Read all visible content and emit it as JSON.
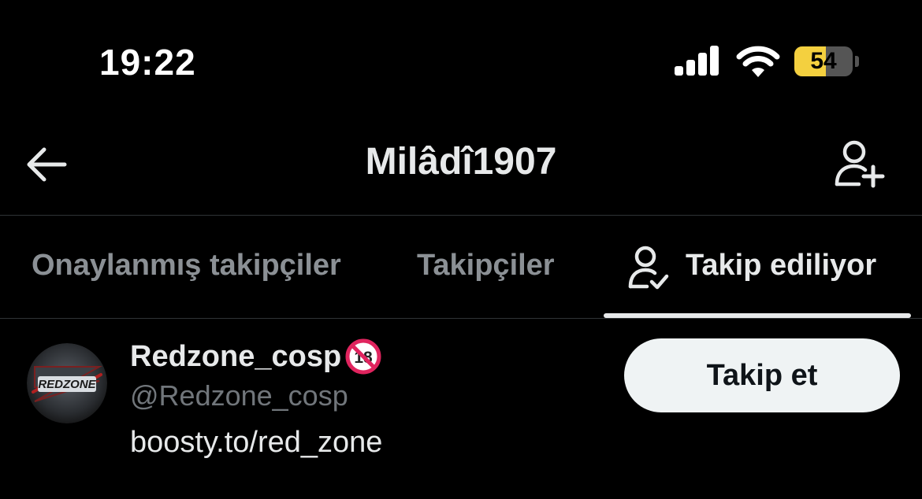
{
  "status_bar": {
    "time": "19:22",
    "battery_percent": "54",
    "battery_level": 0.54,
    "battery_color": "#f4d03f",
    "signal_icon": "cellular-signal-icon",
    "wifi_icon": "wifi-icon"
  },
  "header": {
    "title": "Milâdî1907",
    "back_icon": "back-arrow-icon",
    "add_user_icon": "add-user-icon"
  },
  "tabs": [
    {
      "label": "Onaylanmış takipçiler",
      "active": false
    },
    {
      "label": "Takipçiler",
      "active": false
    },
    {
      "label": "Takip ediliyor",
      "active": true,
      "icon": "user-check-icon"
    }
  ],
  "users": [
    {
      "display_name": "Redzone_cosp",
      "badge_icon": "no-under-18-icon",
      "handle": "@Redzone_cosp",
      "bio": "boosty.to/red_zone",
      "avatar_text": "REDZONE",
      "follow_label": "Takip et"
    }
  ],
  "colors": {
    "background": "#000000",
    "text_primary": "#e7e9ea",
    "text_secondary": "#71767b",
    "divider": "#2f3336",
    "button_bg": "#eff3f4"
  }
}
